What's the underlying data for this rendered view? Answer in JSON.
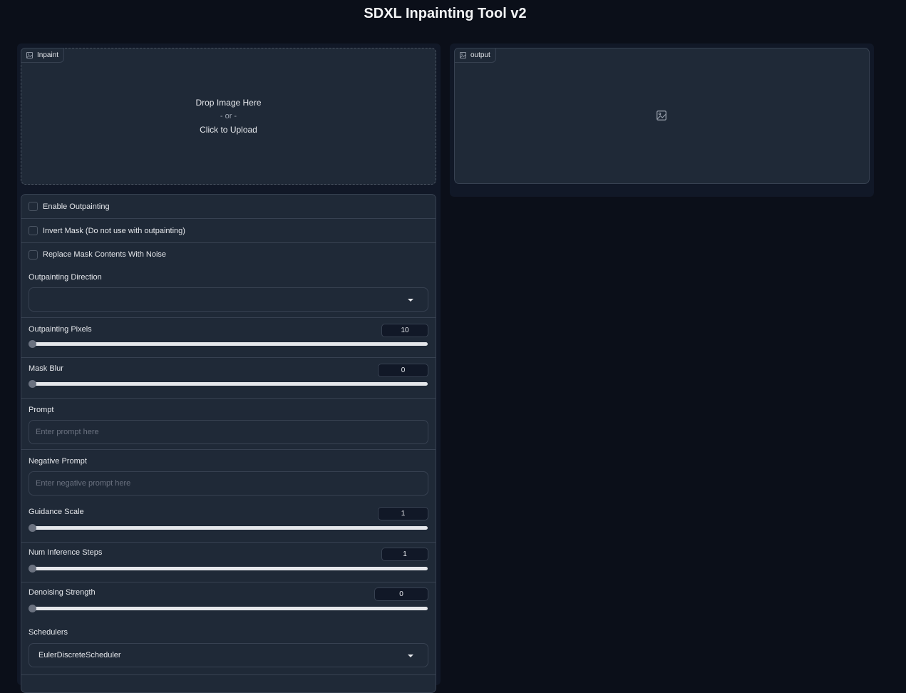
{
  "app": {
    "title": "SDXL Inpainting Tool v2"
  },
  "inpaint": {
    "label": "Inpaint",
    "drop_text": "Drop Image Here",
    "or_text": "- or -",
    "upload_text": "Click to Upload"
  },
  "output": {
    "label": "output"
  },
  "settings": {
    "enable_outpainting": {
      "label": "Enable Outpainting",
      "checked": false
    },
    "invert_mask": {
      "label": "Invert Mask (Do not use with outpainting)",
      "checked": false
    },
    "replace_noise": {
      "label": "Replace Mask Contents With Noise",
      "checked": false
    },
    "outpainting_direction": {
      "label": "Outpainting Direction",
      "value": ""
    },
    "outpainting_pixels": {
      "label": "Outpainting Pixels",
      "value": "10"
    },
    "mask_blur": {
      "label": "Mask Blur",
      "value": "0"
    },
    "prompt": {
      "label": "Prompt",
      "placeholder": "Enter prompt here"
    },
    "negative_prompt": {
      "label": "Negative Prompt",
      "placeholder": "Enter negative prompt here"
    },
    "guidance_scale": {
      "label": "Guidance Scale",
      "value": "1"
    },
    "num_inference_steps": {
      "label": "Num Inference Steps",
      "value": "1"
    },
    "denoising_strength": {
      "label": "Denoising Strength",
      "value": "0"
    },
    "schedulers": {
      "label": "Schedulers",
      "value": "EulerDiscreteScheduler"
    }
  },
  "icons": {
    "image": "image-icon",
    "dropdown": "chevron-down-icon"
  },
  "colors": {
    "background": "#0b0f19",
    "panel": "#1f2937",
    "border": "#374151",
    "text": "#e5e7eb"
  }
}
